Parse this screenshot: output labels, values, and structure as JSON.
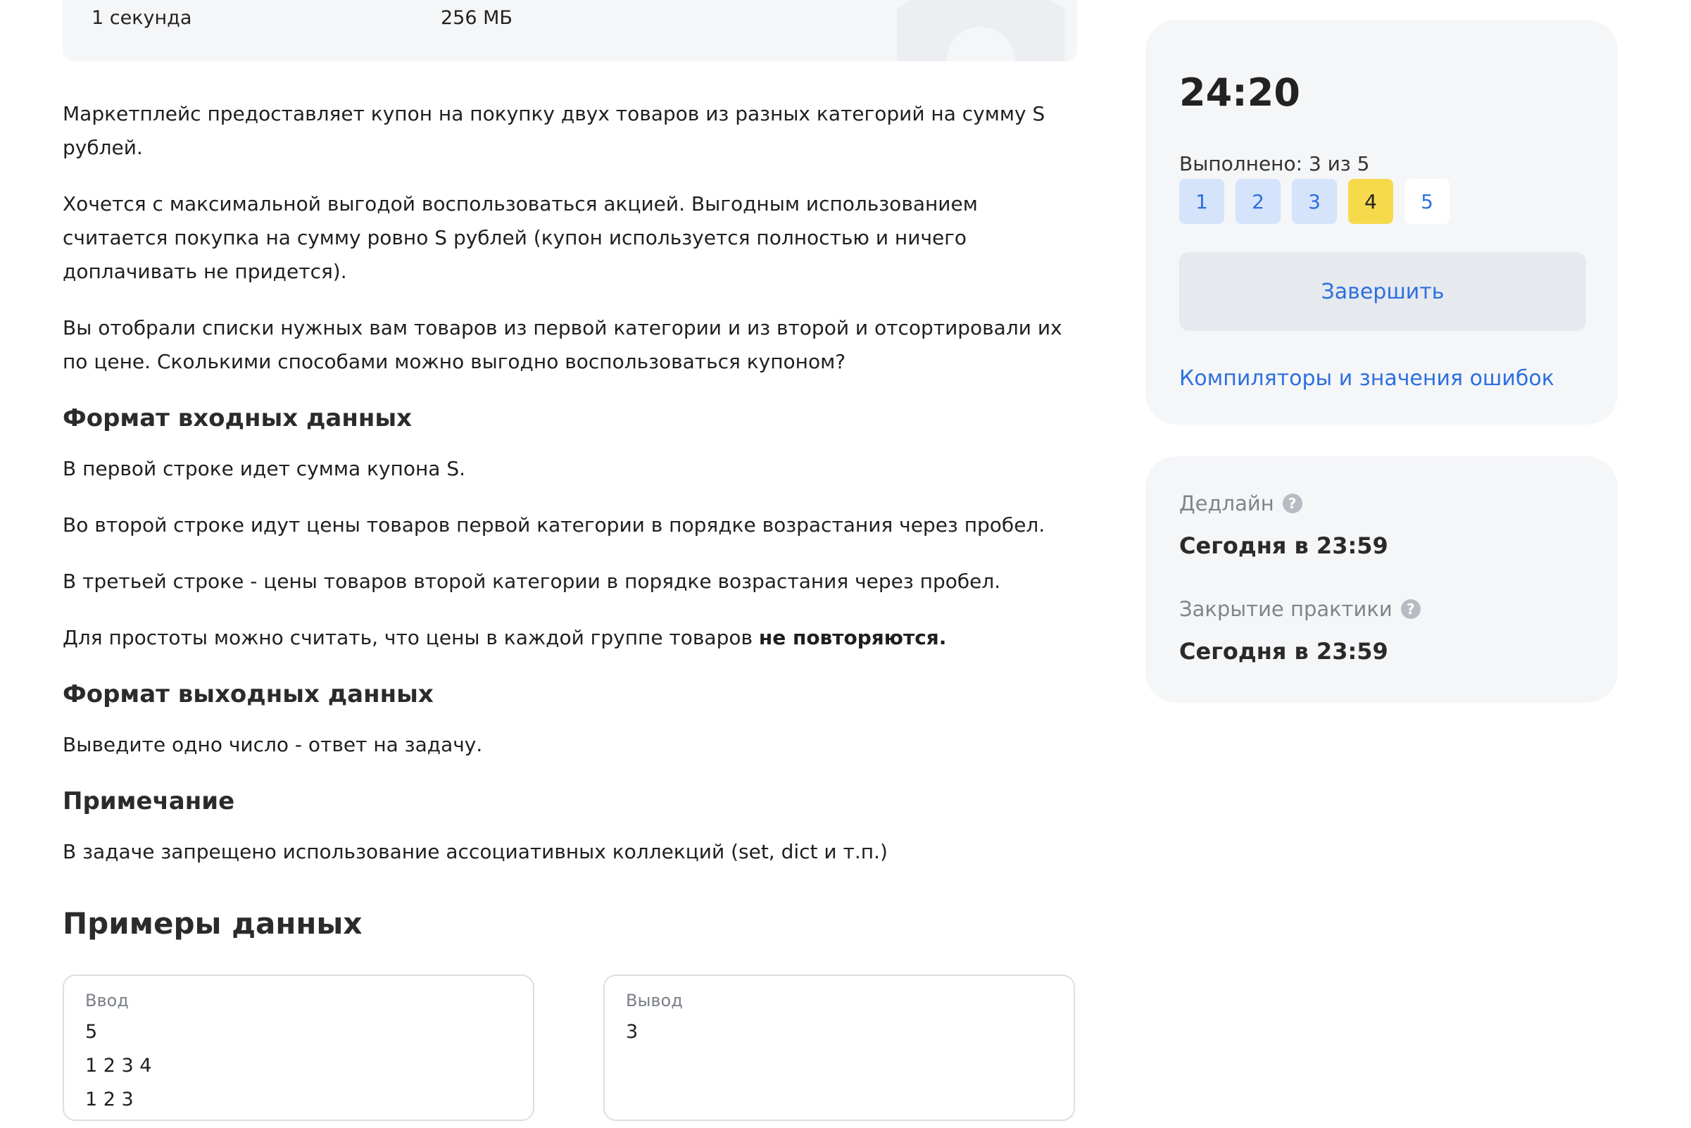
{
  "limits": {
    "time": "1 секунда",
    "memory": "256 МБ"
  },
  "statement": {
    "p1": "Маркетплейс предоставляет купон на покупку двух товаров из разных категорий на сумму S рублей.",
    "p2": "Хочется с максимальной выгодой воспользоваться акцией. Выгодным использованием считается покупка на сумму ровно S рублей (купон используется полностью и ничего доплачивать не придется).",
    "p3": "Вы отобрали списки нужных вам товаров из первой категории и из второй и отсортировали их по цене. Сколькими способами можно выгодно воспользоваться купоном?"
  },
  "input_format": {
    "title": "Формат входных данных",
    "line1": "В первой строке идет сумма купона S.",
    "line2": "Во второй строке идут цены товаров первой категории в порядке возрастания через пробел.",
    "line3": "В третьей строке - цены товаров второй категории в порядке возрастания через пробел.",
    "line4_prefix": "Для простоты можно считать, что цены в каждой группе товаров ",
    "line4_bold": "не повторяются."
  },
  "output_format": {
    "title": "Формат выходных данных",
    "line1": "Выведите одно число - ответ на задачу."
  },
  "note": {
    "title": "Примечание",
    "line1": "В задаче запрещено использование ассоциативных коллекций (set, dict и т.п.)"
  },
  "examples": {
    "title": "Примеры данных",
    "input_label": "Ввод",
    "input_lines": [
      "5",
      "1 2 3 4",
      "1 2 3"
    ],
    "output_label": "Вывод",
    "output_lines": [
      "3"
    ]
  },
  "sidebar": {
    "timer": "24:20",
    "progress": "Выполнено: 3 из 5",
    "tasks": [
      {
        "label": "1",
        "state": "done"
      },
      {
        "label": "2",
        "state": "done"
      },
      {
        "label": "3",
        "state": "done"
      },
      {
        "label": "4",
        "state": "current"
      },
      {
        "label": "5",
        "state": "pending"
      }
    ],
    "finish_label": "Завершить",
    "compilers_link": "Компиляторы и значения ошибок",
    "deadline_label": "Дедлайн",
    "deadline_value": "Сегодня в 23:59",
    "close_label": "Закрытие практики",
    "close_value": "Сегодня в 23:59",
    "help_icon": "question-circle-icon",
    "colors": {
      "accent": "#2d6fe0",
      "done_bg": "#d5e3fb",
      "current_bg": "#f7d94c"
    }
  }
}
